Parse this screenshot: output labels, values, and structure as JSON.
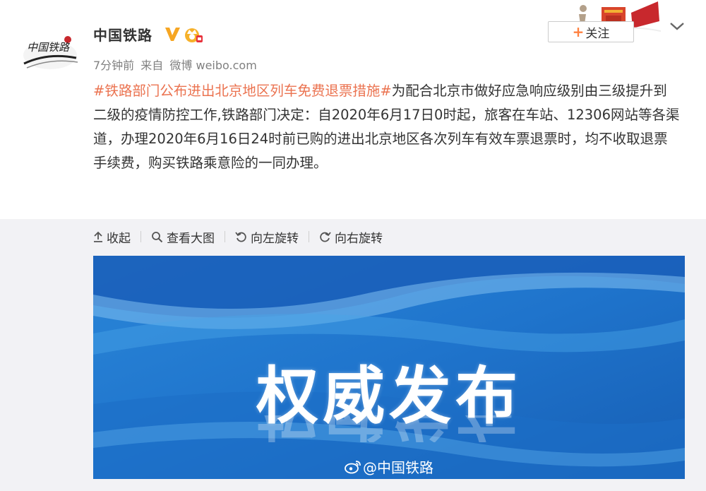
{
  "account": {
    "name": "中国铁路",
    "avatar_text": "中国铁路",
    "verified_icon": "verified-v-icon",
    "member_icon": "member-crown-icon"
  },
  "meta": {
    "time": "7分钟前",
    "source_prefix": "来自",
    "source": "微博 weibo.com"
  },
  "header": {
    "follow_label": "关注",
    "follow_plus": "+",
    "dropdown_icon": "chevron-down-icon"
  },
  "post": {
    "topic": "#铁路部门公布进出北京地区列车免费退票措施#",
    "body": "为配合北京市做好应急响应级别由三级提升到二级的疫情防控工作,铁路部门决定：自2020年6月17日0时起，旅客在车站、12306网站等各渠道，办理2020年6月16日24时前已购的进出北京地区各次列车有效车票退票时，均不收取退票手续费，购买铁路乘意险的一同办理。"
  },
  "media_toolbar": {
    "collapse": "收起",
    "view_large": "查看大图",
    "rotate_left": "向左旋转",
    "rotate_right": "向右旋转"
  },
  "image": {
    "headline": "权威发布",
    "watermark": "@中国铁路"
  },
  "colors": {
    "topic": "#eb7350",
    "follow_plus": "#ff8140",
    "image_blue": "#1f78d1",
    "media_bg": "#f2f2f5"
  }
}
